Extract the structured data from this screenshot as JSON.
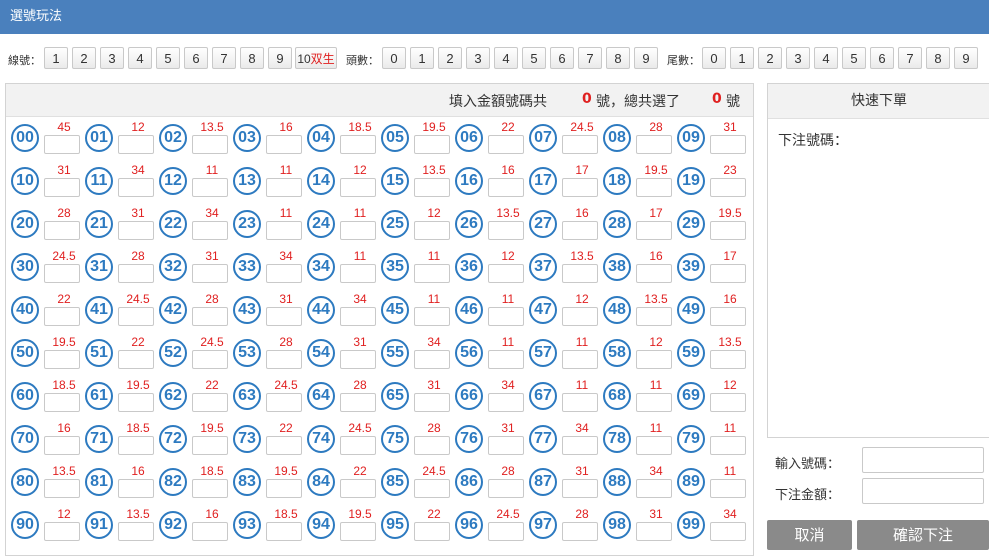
{
  "title": "選號玩法",
  "filters": {
    "line_label": "線號：",
    "line_buttons": [
      "1",
      "2",
      "3",
      "4",
      "5",
      "6",
      "7",
      "8",
      "9"
    ],
    "line_last_num": "10",
    "line_last_suffix": "双生",
    "head_label": "頭數：",
    "head_buttons": [
      "0",
      "1",
      "2",
      "3",
      "4",
      "5",
      "6",
      "7",
      "8",
      "9"
    ],
    "tail_label": "尾數：",
    "tail_buttons": [
      "0",
      "1",
      "2",
      "3",
      "4",
      "5",
      "6",
      "7",
      "8",
      "9"
    ]
  },
  "grid": {
    "header_prefix": "填入金額號碼共",
    "count_filled": "0",
    "header_middle": "號，總共選了",
    "count_selected": "0",
    "header_suffix": "號",
    "odds": [
      "45",
      "12",
      "13.5",
      "16",
      "18.5",
      "19.5",
      "22",
      "24.5",
      "28",
      "31",
      "31",
      "34",
      "11",
      "11",
      "12",
      "13.5",
      "16",
      "17",
      "19.5",
      "23",
      "28",
      "31",
      "34",
      "11",
      "11",
      "12",
      "13.5",
      "16",
      "17",
      "19.5",
      "24.5",
      "28",
      "31",
      "34",
      "11",
      "11",
      "12",
      "13.5",
      "16",
      "17",
      "22",
      "24.5",
      "28",
      "31",
      "34",
      "11",
      "11",
      "12",
      "13.5",
      "16",
      "19.5",
      "22",
      "24.5",
      "28",
      "31",
      "34",
      "11",
      "11",
      "12",
      "13.5",
      "18.5",
      "19.5",
      "22",
      "24.5",
      "28",
      "31",
      "34",
      "11",
      "11",
      "12",
      "16",
      "18.5",
      "19.5",
      "22",
      "24.5",
      "28",
      "31",
      "34",
      "11",
      "11",
      "13.5",
      "16",
      "18.5",
      "19.5",
      "22",
      "24.5",
      "28",
      "31",
      "34",
      "11",
      "12",
      "13.5",
      "16",
      "18.5",
      "19.5",
      "22",
      "24.5",
      "28",
      "31",
      "34"
    ]
  },
  "quick": {
    "title": "快速下單",
    "bet_numbers_label": "下注號碼："
  },
  "form": {
    "input_numbers_label": "輸入號碼：",
    "bet_amount_label": "下注金額："
  },
  "buttons": {
    "cancel": "取消",
    "confirm": "確認下注"
  },
  "colors": {
    "title_bar": "#4a80bd",
    "ball_blue": "#2d7ac0",
    "odds_red": "#e02020",
    "button_gray": "#8a8a8a"
  }
}
